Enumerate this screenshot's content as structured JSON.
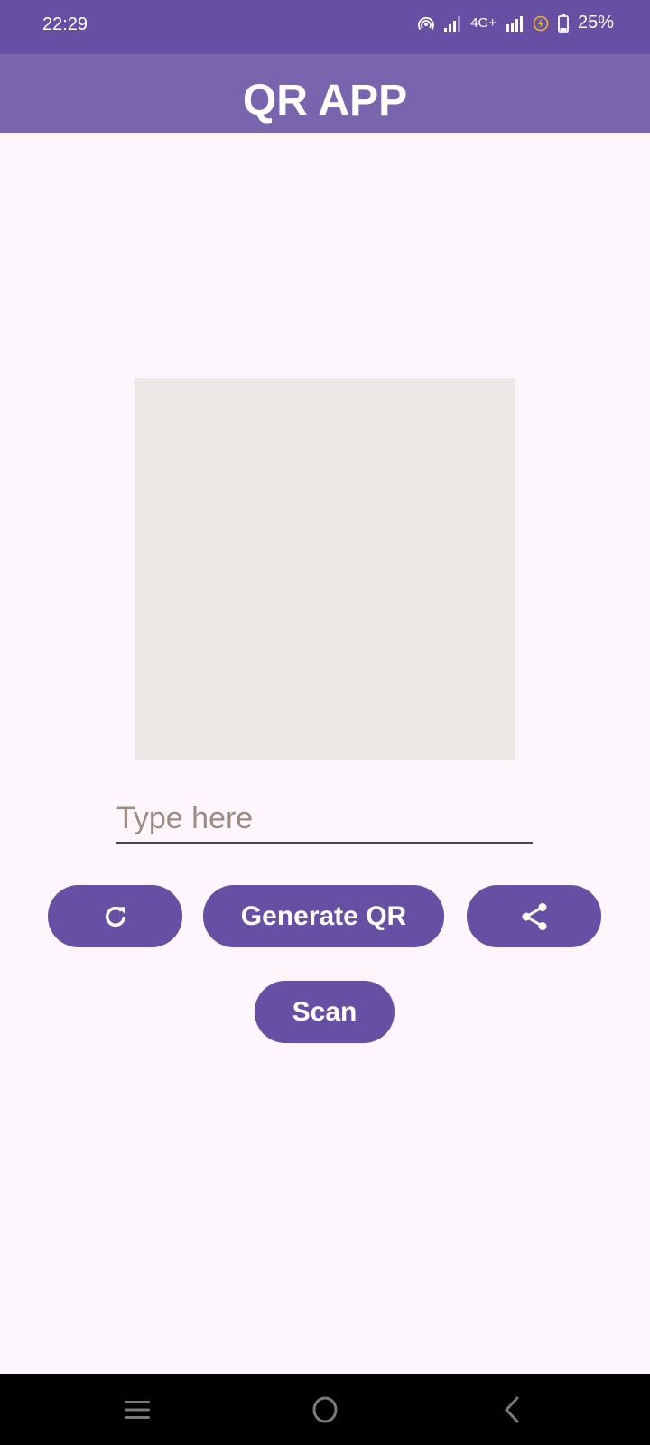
{
  "status_bar": {
    "time": "22:29",
    "network": "4G+",
    "battery": "25%",
    "icons": [
      "hotspot-icon",
      "signal-icon",
      "signal-icon",
      "battery-saver-icon",
      "battery-icon"
    ]
  },
  "app_bar": {
    "title": "QR APP"
  },
  "qr_preview": {
    "state": "empty"
  },
  "input": {
    "value": "",
    "placeholder": "Type here"
  },
  "buttons": {
    "refresh_icon": "refresh-icon",
    "generate_label": "Generate QR",
    "share_icon": "share-icon",
    "scan_label": "Scan"
  },
  "nav_bar": {
    "items": [
      "recents-icon",
      "home-icon",
      "back-icon"
    ]
  },
  "colors": {
    "primary": "#6750a4",
    "app_bar": "#7965ae",
    "background": "#fdf7fd",
    "qr_placeholder": "#ece8e6",
    "hint": "#9e8a80"
  }
}
